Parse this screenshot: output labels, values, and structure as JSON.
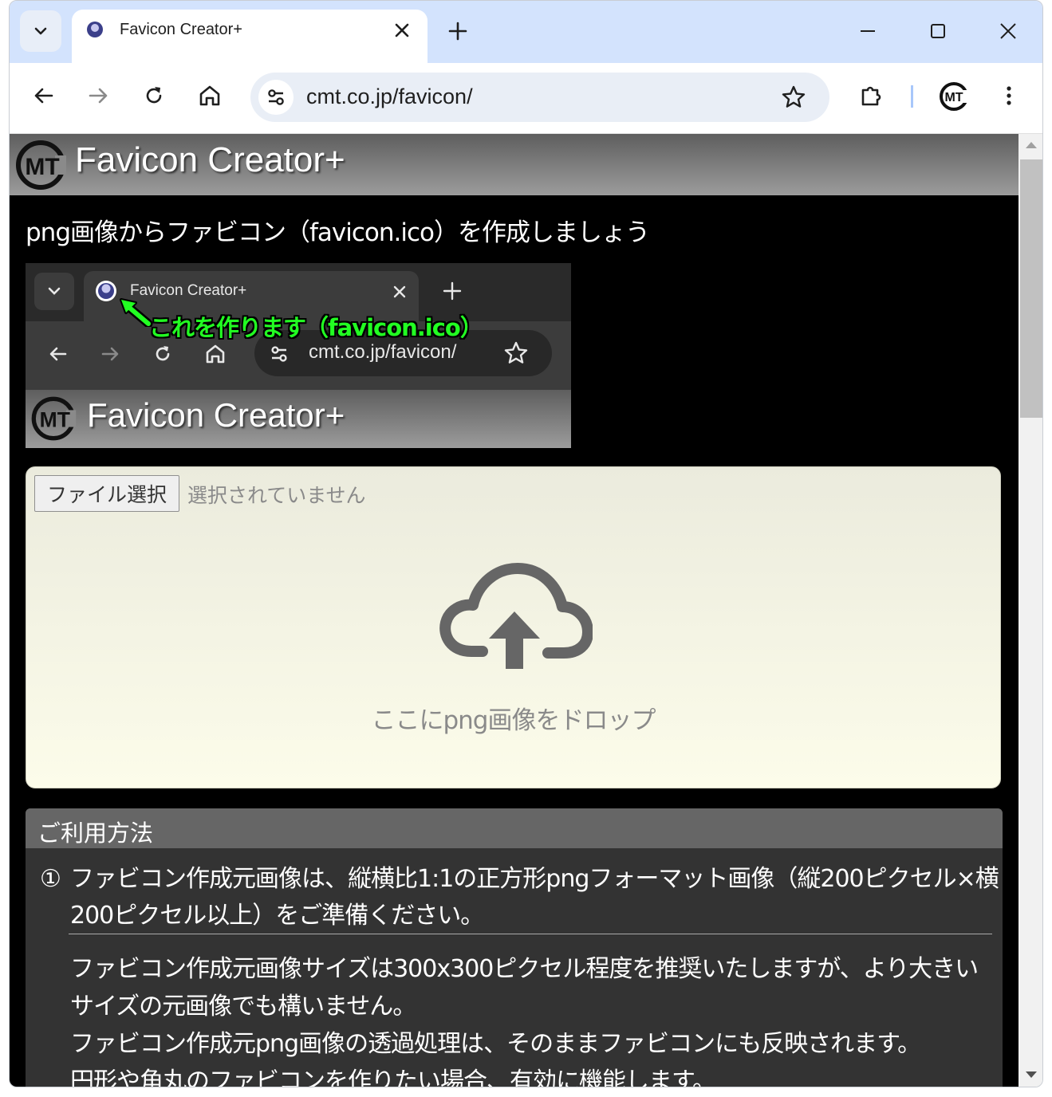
{
  "browser": {
    "tab": {
      "title": "Favicon Creator+"
    },
    "omnibox": {
      "url": "cmt.co.jp/favicon/"
    }
  },
  "page": {
    "site_title": "Favicon Creator+",
    "lead": "png画像からファビコン（favicon.ico）を作成しましょう",
    "demo": {
      "tab_title": "Favicon Creator+",
      "annotation": "これを作ります（favicon.ico）",
      "url": "cmt.co.jp/favicon/",
      "site_title": "Favicon Creator+"
    },
    "dropzone": {
      "file_button": "ファイル選択",
      "file_status": "選択されていません",
      "drop_text": "ここにpng画像をドロップ"
    },
    "usage": {
      "title": "ご利用方法",
      "step1_num": "①",
      "step1_text": "ファビコン作成元画像は、縦横比1:1の正方形pngフォーマット画像（縦200ピクセル×横200ピクセル以上）をご準備ください。",
      "note_lines": [
        "ファビコン作成元画像サイズは300x300ピクセル程度を推奨いたしますが、より大きいサイズの元画像でも構いません。",
        "ファビコン作成元png画像の透過処理は、そのままファビコンにも反映されます。",
        "円形や角丸のファビコンを作りたい場合、有効に機能します。"
      ]
    }
  },
  "icons": {
    "tab_menu": "chevron-down-icon",
    "tab_close": "close-icon",
    "new_tab": "plus-icon",
    "minimize": "minimize-icon",
    "maximize": "maximize-icon",
    "close_window": "close-icon",
    "back": "arrow-left-icon",
    "forward": "arrow-right-icon",
    "reload": "reload-icon",
    "home": "home-icon",
    "site_info": "tune-icon",
    "bookmark": "star-icon",
    "extensions": "puzzle-icon",
    "profile": "cmt-logo-icon",
    "menu": "more-vert-icon",
    "upload": "cloud-upload-icon"
  },
  "colors": {
    "tabstrip": "#d3e3fd",
    "page_background": "#000000",
    "annotation": "#22ff22",
    "dropzone_top": "#ebebdd",
    "usage_header": "#666666"
  }
}
